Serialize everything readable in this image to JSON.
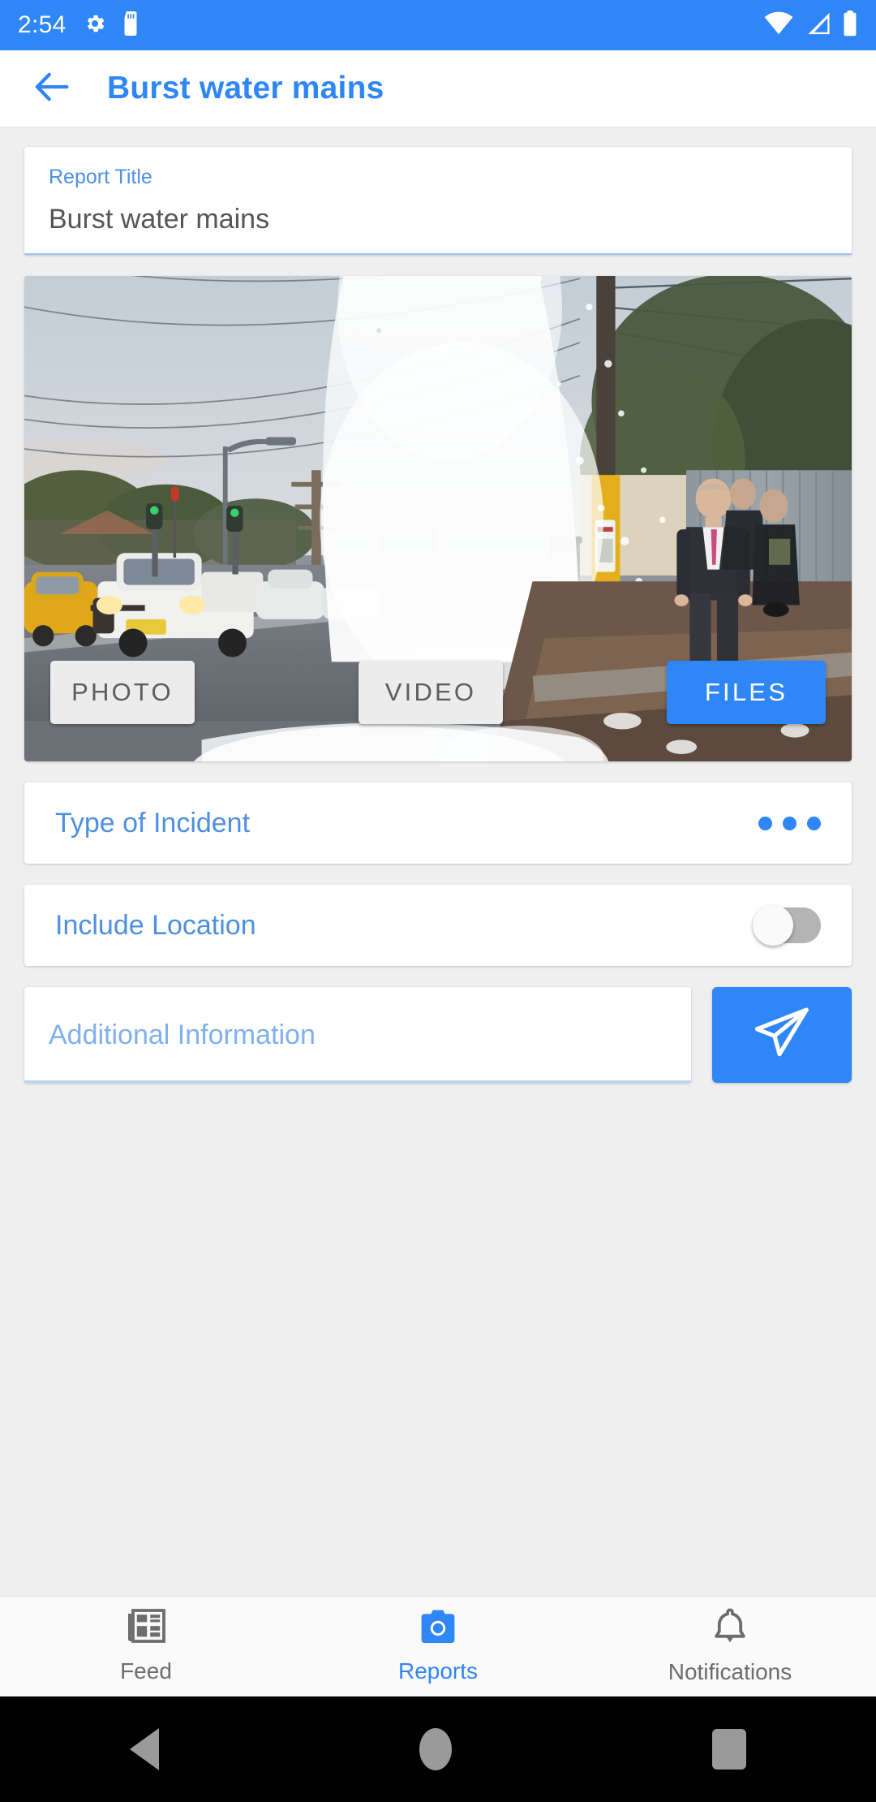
{
  "statusbar": {
    "time": "2:54",
    "icons_left": [
      "settings-gear-icon",
      "sd-card-icon"
    ],
    "icons_right": [
      "wifi-icon",
      "cellular-signal-icon",
      "battery-icon"
    ]
  },
  "appbar": {
    "back_icon": "arrow-left-icon",
    "title": "Burst water mains",
    "title_color": "#2f86f6"
  },
  "report_title_field": {
    "label": "Report Title",
    "value": "Burst water mains"
  },
  "media": {
    "photo_alt": "Burst water main spraying water high into the air on a suburban road, with a white utility truck, traffic lights, power poles and a man in a dark suit standing on wet rubble-strewn ground",
    "buttons": [
      {
        "label": "PHOTO",
        "style": "light"
      },
      {
        "label": "VIDEO",
        "style": "light"
      },
      {
        "label": "FILES",
        "style": "primary"
      }
    ]
  },
  "incident_row": {
    "label": "Type of Incident",
    "trailing_icon": "more-horizontal-dots-icon"
  },
  "location_row": {
    "label": "Include Location",
    "toggle_state": "off"
  },
  "additional_info": {
    "placeholder": "Additional Information",
    "value": "",
    "send_icon": "send-paper-plane-icon"
  },
  "bottomnav": {
    "items": [
      {
        "label": "Feed",
        "icon": "newspaper-icon",
        "active": false
      },
      {
        "label": "Reports",
        "icon": "camera-icon",
        "active": true
      },
      {
        "label": "Notifications",
        "icon": "bell-icon",
        "active": false
      }
    ],
    "active_color": "#2f86f6",
    "inactive_color": "#6d6d6d"
  },
  "androidnav": {
    "buttons": [
      "back-triangle-icon",
      "home-circle-icon",
      "recents-square-icon"
    ]
  },
  "theme": {
    "accent": "#2f86f6",
    "page_background": "#efefef",
    "card_background": "#ffffff"
  }
}
